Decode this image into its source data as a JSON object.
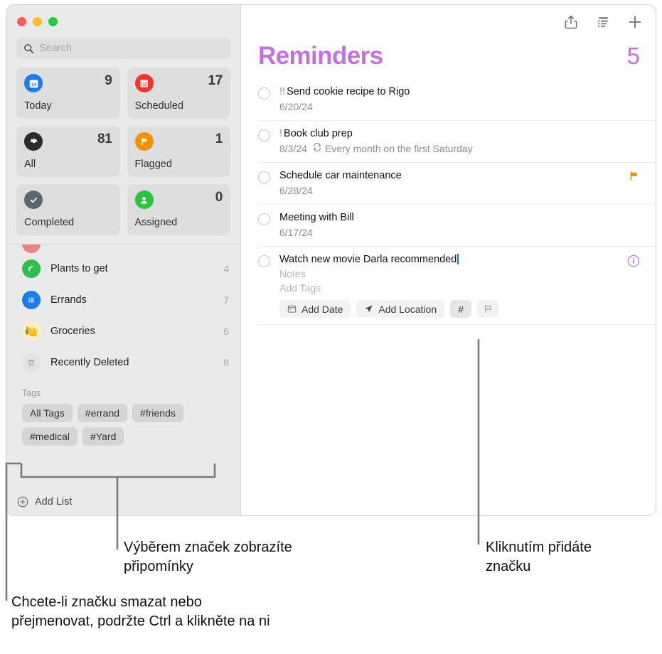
{
  "window": {
    "traffic_lights": [
      "close",
      "minimize",
      "zoom"
    ]
  },
  "sidebar": {
    "search": {
      "placeholder": "Search",
      "value": "",
      "icon": "search-icon"
    },
    "smart_lists": [
      {
        "label": "Today",
        "count": "9",
        "icon": "calendar-icon",
        "color": "#1a7ced"
      },
      {
        "label": "Scheduled",
        "count": "17",
        "icon": "calendar-days-icon",
        "color": "#f5342b"
      },
      {
        "label": "All",
        "count": "81",
        "icon": "inbox-icon",
        "color": "#2b2b2b"
      },
      {
        "label": "Flagged",
        "count": "1",
        "icon": "flag-icon",
        "color": "#f29100"
      },
      {
        "label": "Completed",
        "count": "",
        "icon": "checkmark-icon",
        "color": "#5c6670"
      },
      {
        "label": "Assigned",
        "count": "0",
        "icon": "person-icon",
        "color": "#27c43f"
      }
    ],
    "lists": [
      {
        "name": "Plants to get",
        "count": "4",
        "icon": "leaf-icon",
        "color": "#2fbf4f"
      },
      {
        "name": "Errands",
        "count": "7",
        "icon": "list-icon",
        "color": "#1a7ced"
      },
      {
        "name": "Groceries",
        "count": "6",
        "icon": "lemon-icon",
        "color": "#fbf0c0",
        "glyph": "🍋"
      },
      {
        "name": "Recently Deleted",
        "count": "8",
        "icon": "trash-icon",
        "color": "#e2e2e2"
      }
    ],
    "tags": {
      "header": "Tags",
      "items": [
        "All Tags",
        "#errand",
        "#friends",
        "#medical",
        "#Yard"
      ]
    },
    "add_list": {
      "label": "Add List",
      "icon": "plus-circle-icon"
    }
  },
  "main": {
    "toolbar": [
      {
        "name": "share-icon",
        "label": "Share"
      },
      {
        "name": "list-sort-icon",
        "label": "View Options"
      },
      {
        "name": "plus-icon",
        "label": "New Reminder"
      }
    ],
    "title": "Reminders",
    "count": "5",
    "accent_color": "#c471e0",
    "reminders": [
      {
        "priority": "!!",
        "title": "Send cookie recipe to Rigo",
        "date": "6/20/24",
        "repeat": "",
        "flagged": false,
        "editing": false
      },
      {
        "priority": "!",
        "title": "Book club prep",
        "date": "8/3/24",
        "repeat": "Every month on the first Saturday",
        "flagged": false,
        "editing": false
      },
      {
        "priority": "",
        "title": "Schedule car maintenance",
        "date": "6/28/24",
        "repeat": "",
        "flagged": true,
        "editing": false
      },
      {
        "priority": "",
        "title": "Meeting with Bill",
        "date": "6/17/24",
        "repeat": "",
        "flagged": false,
        "editing": false
      },
      {
        "priority": "",
        "title": "Watch new movie Darla recommended",
        "notes_placeholder": "Notes",
        "tags_placeholder": "Add Tags",
        "flagged": false,
        "editing": true,
        "buttons": [
          {
            "label": "Add Date",
            "icon": "calendar-icon"
          },
          {
            "label": "Add Location",
            "icon": "location-arrow-icon"
          },
          {
            "label": "#",
            "icon": "hashtag-icon",
            "active": true
          },
          {
            "label": "",
            "icon": "flag-outline-icon"
          }
        ],
        "info_icon": "info-circle-icon"
      }
    ]
  },
  "callouts": [
    {
      "id": "tags-select",
      "text_line1": "Výběrem značek zobrazíte",
      "text_line2": "připomínky"
    },
    {
      "id": "add-tag",
      "text_line1": "Kliknutím přidáte",
      "text_line2": "značku"
    },
    {
      "id": "tag-edit",
      "text_line1": "Chcete-li značku smazat nebo",
      "text_line2": "přejmenovat, podržte Ctrl a klikněte na ni"
    }
  ]
}
